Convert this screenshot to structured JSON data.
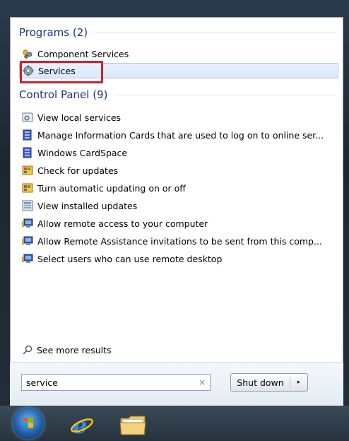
{
  "programs": {
    "header": "Programs (2)",
    "items": [
      {
        "label": "Component Services",
        "icon": "component-services-icon"
      },
      {
        "label": "Services",
        "icon": "services-gear-icon"
      }
    ]
  },
  "control_panel": {
    "header": "Control Panel (9)",
    "items": [
      {
        "label": "View local services",
        "icon": "view-local-services-icon"
      },
      {
        "label": "Manage Information Cards that are used to log on to online ser...",
        "icon": "cardspace-icon"
      },
      {
        "label": "Windows CardSpace",
        "icon": "cardspace-icon"
      },
      {
        "label": "Check for updates",
        "icon": "windows-update-icon"
      },
      {
        "label": "Turn automatic updating on or off",
        "icon": "windows-update-icon"
      },
      {
        "label": "View installed updates",
        "icon": "installed-updates-icon"
      },
      {
        "label": "Allow remote access to your computer",
        "icon": "system-icon"
      },
      {
        "label": "Allow Remote Assistance invitations to be sent from this comp...",
        "icon": "system-icon"
      },
      {
        "label": "Select users who can use remote desktop",
        "icon": "system-icon"
      }
    ]
  },
  "see_more": "See more results",
  "search": {
    "value": "service",
    "clear": "×"
  },
  "shutdown": {
    "label": "Shut down",
    "arrow": "▸"
  },
  "colors": {
    "header": "#1e3287",
    "highlight": "#d0202a",
    "selection": "#d9e8fb"
  }
}
